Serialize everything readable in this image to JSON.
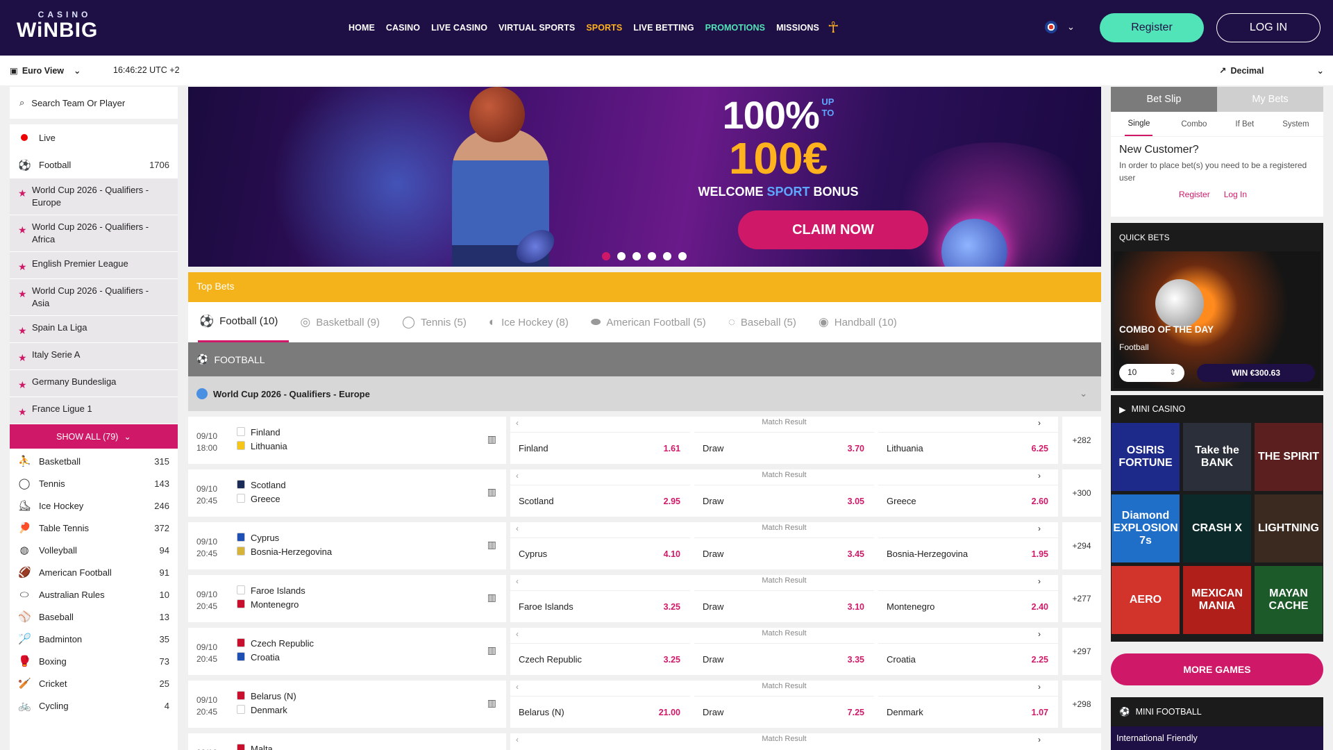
{
  "header": {
    "logo_small": "CASINO",
    "logo_big": "WiNBIG",
    "nav": [
      "HOME",
      "CASINO",
      "LIVE CASINO",
      "VIRTUAL SPORTS",
      "SPORTS",
      "LIVE BETTING",
      "PROMOTIONS",
      "MISSIONS"
    ],
    "register": "Register",
    "login": "LOG IN"
  },
  "subbar": {
    "view": "Euro View",
    "time": "16:46:22 UTC +2",
    "odds_format": "Decimal"
  },
  "sidebar": {
    "search_placeholder": "Search Team Or Player",
    "top_items": [
      {
        "label": "Live",
        "count": ""
      },
      {
        "label": "Football",
        "count": "1706"
      }
    ],
    "leagues": [
      "World Cup 2026 - Qualifiers - Europe",
      "World Cup 2026 - Qualifiers - Africa",
      "English Premier League",
      "World Cup 2026 - Qualifiers - Asia",
      "Spain La Liga",
      "Italy Serie A",
      "Germany Bundesliga",
      "France Ligue 1"
    ],
    "show_all": "SHOW ALL (79)",
    "sports": [
      {
        "label": "Basketball",
        "count": "315",
        "icon": "⛹"
      },
      {
        "label": "Tennis",
        "count": "143",
        "icon": "◯"
      },
      {
        "label": "Ice Hockey",
        "count": "246",
        "icon": "⛸"
      },
      {
        "label": "Table Tennis",
        "count": "372",
        "icon": "🏓"
      },
      {
        "label": "Volleyball",
        "count": "94",
        "icon": "◍"
      },
      {
        "label": "American Football",
        "count": "91",
        "icon": "🏈"
      },
      {
        "label": "Australian Rules",
        "count": "10",
        "icon": "⬭"
      },
      {
        "label": "Baseball",
        "count": "13",
        "icon": "⚾"
      },
      {
        "label": "Badminton",
        "count": "35",
        "icon": "🏸"
      },
      {
        "label": "Boxing",
        "count": "73",
        "icon": "🥊"
      },
      {
        "label": "Cricket",
        "count": "25",
        "icon": "🏏"
      },
      {
        "label": "Cycling",
        "count": "4",
        "icon": "🚲"
      }
    ]
  },
  "banner": {
    "pct": "100%",
    "upto_1": "UP",
    "upto_2": "TO",
    "amount": "100€",
    "welcome_a": "WELCOME ",
    "welcome_b": "SPORT",
    "welcome_c": " BONUS",
    "cta": "CLAIM NOW"
  },
  "top_bets": "Top Bets",
  "sport_tabs": [
    {
      "label": "Football (10)",
      "icon": "⚽",
      "active": true
    },
    {
      "label": "Basketball (9)",
      "icon": "◎",
      "active": false
    },
    {
      "label": "Tennis (5)",
      "icon": "◯",
      "active": false
    },
    {
      "label": "Ice Hockey (8)",
      "icon": "◐",
      "active": false
    },
    {
      "label": "American Football (5)",
      "icon": "⬬",
      "active": false
    },
    {
      "label": "Baseball (5)",
      "icon": "◌",
      "active": false
    },
    {
      "label": "Handball (10)",
      "icon": "◉",
      "active": false
    }
  ],
  "section": "FOOTBALL",
  "competition": "World Cup 2026 - Qualifiers - Europe",
  "market_title": "Match Result",
  "matches": [
    {
      "date": "09/10",
      "time": "18:00",
      "home": "Finland",
      "away": "Lithuania",
      "h": "1.61",
      "d": "3.70",
      "a": "6.25",
      "more": "+282",
      "hc": "#ffffff",
      "ac": "#f5c518"
    },
    {
      "date": "09/10",
      "time": "20:45",
      "home": "Scotland",
      "away": "Greece",
      "h": "2.95",
      "d": "3.05",
      "a": "2.60",
      "more": "+300",
      "hc": "#1a2b57",
      "ac": "#ffffff"
    },
    {
      "date": "09/10",
      "time": "20:45",
      "home": "Cyprus",
      "away": "Bosnia-Herzegovina",
      "h": "4.10",
      "d": "3.45",
      "a": "1.95",
      "more": "+294",
      "hc": "#1e4fb5",
      "ac": "#d8b33a"
    },
    {
      "date": "09/10",
      "time": "20:45",
      "home": "Faroe Islands",
      "away": "Montenegro",
      "h": "3.25",
      "d": "3.10",
      "a": "2.40",
      "more": "+277",
      "hc": "#ffffff",
      "ac": "#c8102e"
    },
    {
      "date": "09/10",
      "time": "20:45",
      "home": "Czech Republic",
      "away": "Croatia",
      "h": "3.25",
      "d": "3.35",
      "a": "2.25",
      "more": "+297",
      "hc": "#c8102e",
      "ac": "#1e4fb5"
    },
    {
      "date": "09/10",
      "time": "20:45",
      "home": "Belarus (N)",
      "away": "Denmark",
      "h": "21.00",
      "d": "7.25",
      "a": "1.07",
      "more": "+298",
      "hc": "#c8102e",
      "ac": "#ffffff"
    },
    {
      "date": "09/10",
      "time": "",
      "home": "Malta",
      "away": "",
      "h": "",
      "d": "",
      "a": "",
      "more": "",
      "hc": "#c8102e",
      "ac": "#ffffff"
    }
  ],
  "draw_label": "Draw",
  "betslip": {
    "tab_active": "Bet Slip",
    "tab_other": "My Bets",
    "sub": [
      "Single",
      "Combo",
      "If Bet",
      "System"
    ],
    "title": "New Customer?",
    "text": "In order to place bet(s) you need to be a registered user",
    "register": "Register",
    "login": "Log In"
  },
  "quickbets": {
    "head": "QUICK BETS",
    "title": "COMBO OF THE DAY",
    "sub": "Football",
    "stake": "10",
    "win": "WIN €300.63"
  },
  "minicasino": {
    "head": "MINI CASINO",
    "games": [
      {
        "name": "OSIRIS FORTUNE",
        "bg": "#1e2a8a"
      },
      {
        "name": "Take the BANK",
        "bg": "#2a2f3a"
      },
      {
        "name": "THE SPIRIT",
        "bg": "#5b1f1f"
      },
      {
        "name": "Diamond EXPLOSION 7s",
        "bg": "#1f6fc9"
      },
      {
        "name": "CRASH X",
        "bg": "#0c2a2a"
      },
      {
        "name": "LIGHTNING",
        "bg": "#3a2a20"
      },
      {
        "name": "AERO",
        "bg": "#d2332b"
      },
      {
        "name": "MEXICAN MANIA",
        "bg": "#b01f1a"
      },
      {
        "name": "MAYAN CACHE",
        "bg": "#1d5a2a"
      }
    ],
    "more": "MORE GAMES"
  },
  "minifootball": {
    "head": "MINI FOOTBALL",
    "sub": "International Friendly"
  },
  "colors": {
    "brand_dark": "#1e0f45",
    "accent_pink": "#d01868",
    "mint": "#51e4b8",
    "orange": "#f5b31b"
  }
}
